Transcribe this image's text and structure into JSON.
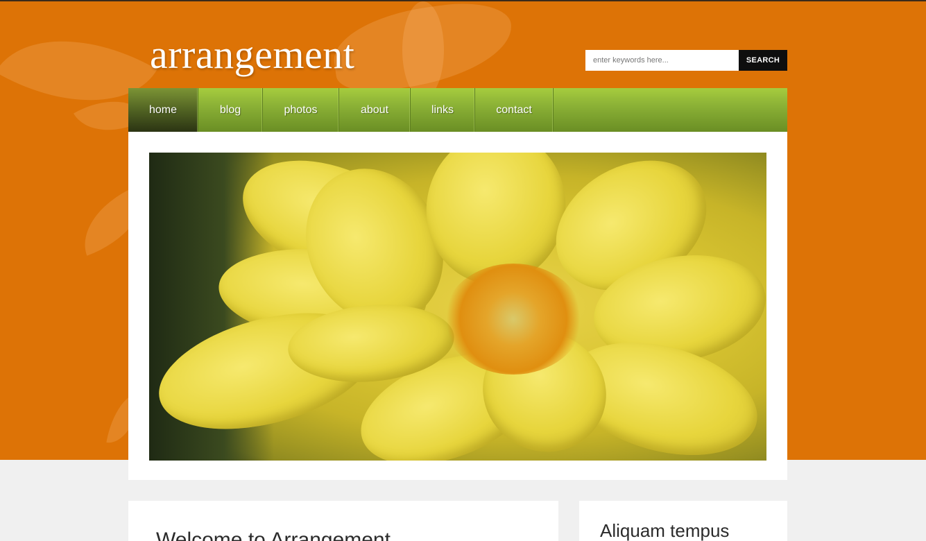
{
  "header": {
    "logo": "arrangement",
    "search": {
      "placeholder": "enter keywords here...",
      "button_label": "SEARCH"
    }
  },
  "nav": {
    "items": [
      {
        "label": "home",
        "active": true
      },
      {
        "label": "blog",
        "active": false
      },
      {
        "label": "photos",
        "active": false
      },
      {
        "label": "about",
        "active": false
      },
      {
        "label": "links",
        "active": false
      },
      {
        "label": "contact",
        "active": false
      }
    ]
  },
  "banner": {
    "image": "yellow-dahlia-flower"
  },
  "content": {
    "title": "Welcome to Arrangement"
  },
  "sidebar": {
    "title": "Aliquam tempus"
  },
  "colors": {
    "brand_orange": "#dd7306",
    "nav_green": "#8bb136",
    "search_button": "#0e0e0e",
    "page_background": "#f0f0f0"
  }
}
